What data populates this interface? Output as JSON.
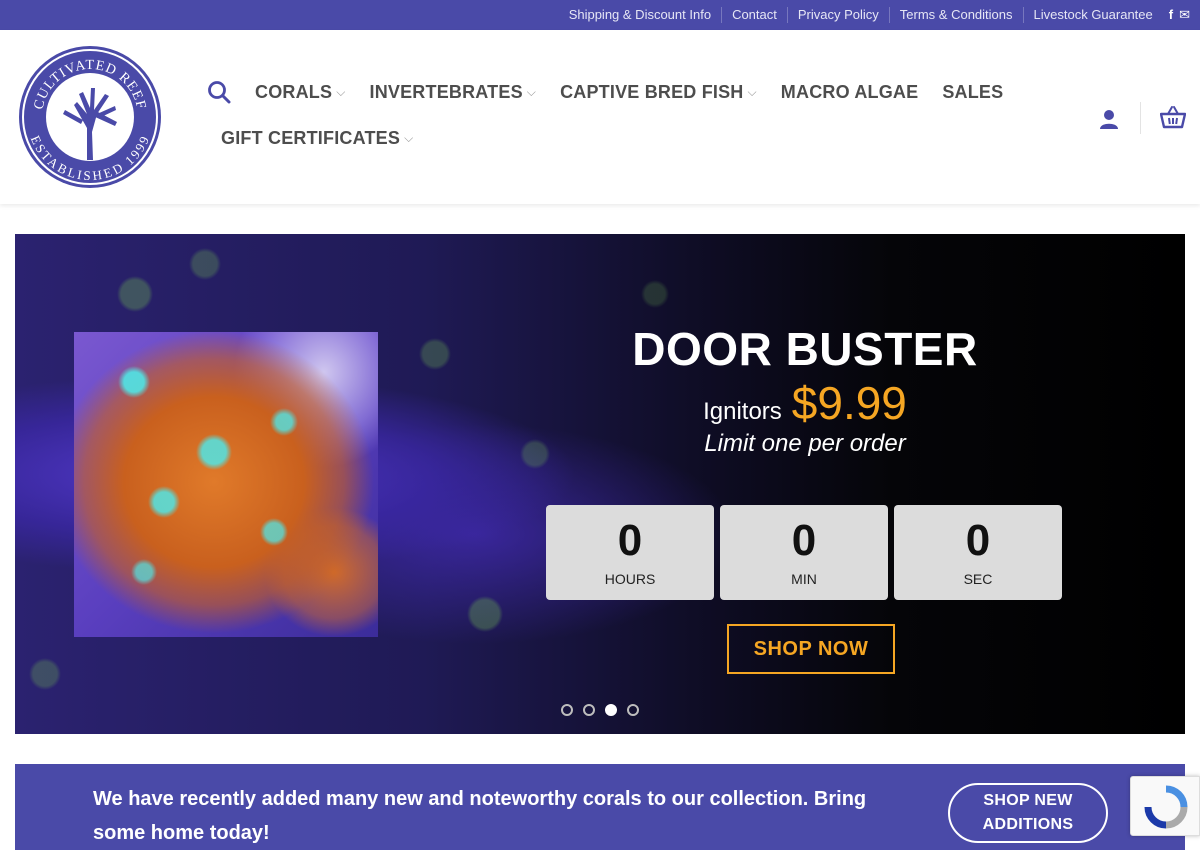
{
  "topbar": {
    "links": [
      "Shipping & Discount Info",
      "Contact",
      "Privacy Policy",
      "Terms & Conditions",
      "Livestock Guarantee"
    ],
    "social_icons": [
      "facebook-icon",
      "email-icon"
    ],
    "facebook_glyph": "f",
    "email_glyph": "✉"
  },
  "logo": {
    "top_text": "CULTIVATED REEF",
    "bottom_text": "ESTABLISHED 1999"
  },
  "nav": {
    "row1": [
      {
        "label": "CORALS",
        "dropdown": true
      },
      {
        "label": "INVERTEBRATES",
        "dropdown": true
      },
      {
        "label": "CAPTIVE BRED FISH",
        "dropdown": true
      },
      {
        "label": "MACRO ALGAE",
        "dropdown": false
      },
      {
        "label": "SALES",
        "dropdown": false
      }
    ],
    "row2": [
      {
        "label": "GIFT CERTIFICATES",
        "dropdown": true
      }
    ],
    "chevron": "⌵"
  },
  "hero": {
    "title": "DOOR BUSTER",
    "product_name": "Ignitors",
    "price": "$9.99",
    "note": "Limit one per order",
    "countdown": [
      {
        "value": "0",
        "label": "HOURS"
      },
      {
        "value": "0",
        "label": "MIN"
      },
      {
        "value": "0",
        "label": "SEC"
      }
    ],
    "cta": "SHOP NOW",
    "slides": 4,
    "active_slide": 3
  },
  "banner": {
    "text": "We have recently added many new and noteworthy corals to our collection. Bring some home today!",
    "button_line1": "SHOP NEW",
    "button_line2": "ADDITIONS"
  },
  "colors": {
    "brand": "#4a4aa8",
    "accent": "#f5a623",
    "nav_text": "#4d4d4d"
  }
}
